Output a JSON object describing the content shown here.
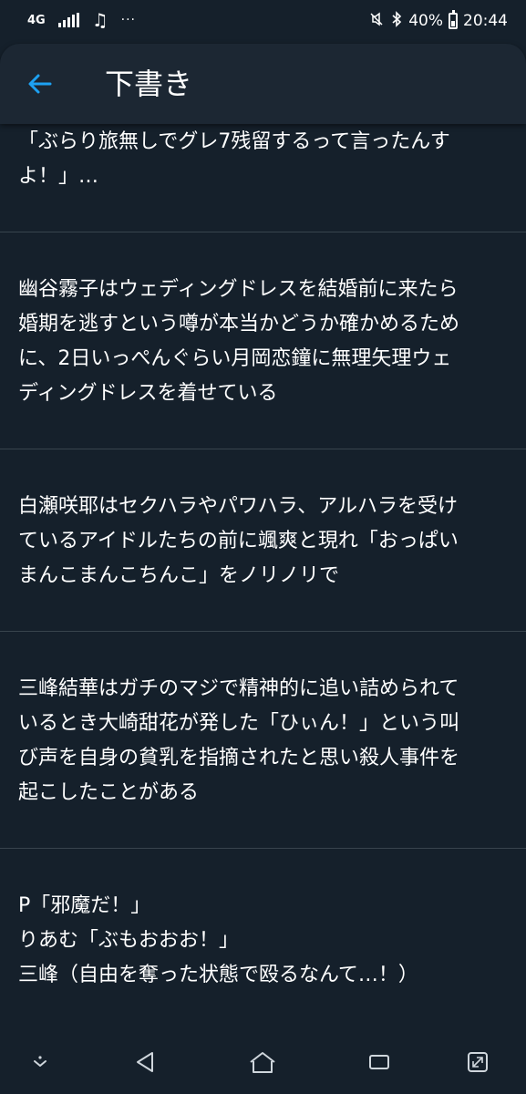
{
  "status_bar": {
    "network": "4G",
    "battery_percent": "40%",
    "time": "20:44",
    "icons": [
      "signal-icon",
      "music-icon",
      "more-dots-icon",
      "mute-icon",
      "bluetooth-icon",
      "battery-icon"
    ]
  },
  "header": {
    "title": "下書き",
    "back_icon": "back-arrow-icon"
  },
  "drafts": [
    {
      "lines": [
        "「ぶらり旅無しでグレ7残留するって言ったんす",
        "よ！」…"
      ]
    },
    {
      "lines": [
        "幽谷霧子はウェディングドレスを結婚前に来たら",
        "婚期を逃すという噂が本当かどうか確かめるため",
        "に、2日いっぺんぐらい月岡恋鐘に無理矢理ウェ",
        "ディングドレスを着せている"
      ]
    },
    {
      "lines": [
        "白瀬咲耶はセクハラやパワハラ、アルハラを受け",
        "ているアイドルたちの前に颯爽と現れ「おっぱい",
        "まんこまんこちんこ」をノリノリで"
      ]
    },
    {
      "lines": [
        "三峰結華はガチのマジで精神的に追い詰められて",
        "いるとき大崎甜花が発した「ひぃん！」という叫",
        "び声を自身の貧乳を指摘されたと思い殺人事件を",
        "起こしたことがある"
      ]
    },
    {
      "lines": [
        "P「邪魔だ！」",
        "りあむ「ぶもおおお！」",
        "三峰（自由を奪った状態で殴るなんて…！）"
      ]
    }
  ],
  "nav_bar": {
    "icons": [
      "hide-keyboard-icon",
      "back-triangle-icon",
      "home-icon",
      "recents-icon",
      "expand-icon"
    ]
  },
  "colors": {
    "background": "#15202b",
    "appbar": "#1c2733",
    "divider": "#38444d",
    "accent": "#1da1f2",
    "text": "#ffffff"
  }
}
